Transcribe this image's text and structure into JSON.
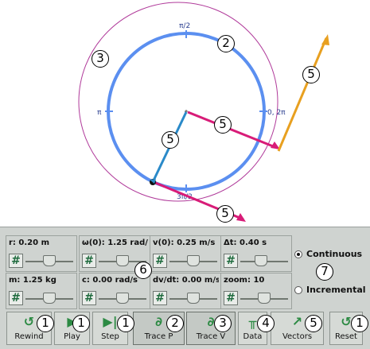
{
  "colors": {
    "orbit": "#5b8ff0",
    "trace": "#b03a9a",
    "force_vector": "#d81c78",
    "accel_vector": "#e8a020",
    "velocity_vector": "#2a8ac9",
    "panel_bg": "#cfd3d0"
  },
  "canvas": {
    "angle_labels": {
      "top": "π/2",
      "left": "π",
      "right": "0, 2π",
      "bottom": "3π/2"
    }
  },
  "controls": [
    {
      "label": "r: 0.20 m",
      "hash": "#",
      "slider": 0.5
    },
    {
      "label": "ω(0): 1.25 rad/s",
      "hash": "#",
      "slider": 0.5
    },
    {
      "label": "v(0): 0.25 m/s",
      "hash": "#",
      "slider": 0.5
    },
    {
      "label": "Δt: 0.40 s",
      "hash": "#",
      "slider": 0.4
    },
    {
      "label": "m: 1.25 kg",
      "hash": "#",
      "slider": 0.5
    },
    {
      "label": "c: 0.00 rad/s",
      "hash": "#",
      "slider": 0.5
    },
    {
      "label": "dv/dt: 0.00 m/s²",
      "hash": "#",
      "slider": 0.5
    },
    {
      "label": "zoom: 10",
      "hash": "#",
      "slider": 0.5
    }
  ],
  "mode": {
    "options": [
      "Continuous",
      "Incremental"
    ],
    "selected": "Continuous"
  },
  "buttons": [
    {
      "label": "Rewind",
      "icon": "rewind-icon",
      "glyph": "↺"
    },
    {
      "label": "Play",
      "icon": "play-icon",
      "glyph": "▶"
    },
    {
      "label": "Step",
      "icon": "step-icon",
      "glyph": "▶|"
    },
    {
      "label": "Trace P",
      "icon": "trace-p-icon",
      "glyph": "∂"
    },
    {
      "label": "Trace V",
      "icon": "trace-v-icon",
      "glyph": "∂"
    },
    {
      "label": "Data",
      "icon": "data-icon",
      "glyph": "╥"
    },
    {
      "label": "Vectors",
      "icon": "vectors-icon",
      "glyph": "↗"
    },
    {
      "label": "Reset",
      "icon": "reset-icon",
      "glyph": "↺"
    }
  ],
  "badges": [
    "1",
    "2",
    "3",
    "4",
    "5",
    "6",
    "7"
  ]
}
